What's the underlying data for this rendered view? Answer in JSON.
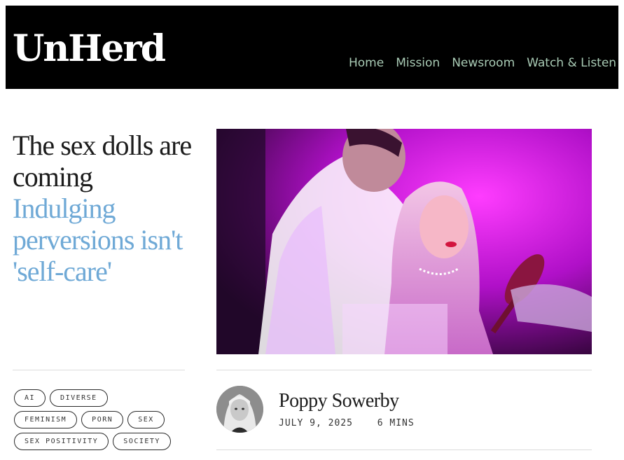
{
  "site": {
    "logo": "UnHerd"
  },
  "nav": {
    "items": [
      "Home",
      "Mission",
      "Newsroom",
      "Watch & Listen"
    ]
  },
  "article": {
    "title": "The sex dolls are coming",
    "subtitle": "Indulging perversions isn't 'self-care'",
    "tags": [
      "AI",
      "DIVERSE",
      "FEMINISM",
      "PORN",
      "SEX",
      "SEX POSITIVITY",
      "SOCIETY"
    ],
    "author": "Poppy Sowerby",
    "date": "JULY 9, 2025",
    "read_time": "6 MINS"
  },
  "colors": {
    "header_bg": "#000000",
    "nav_text": "#a9cbb5",
    "subtitle": "#6fa9d6"
  }
}
